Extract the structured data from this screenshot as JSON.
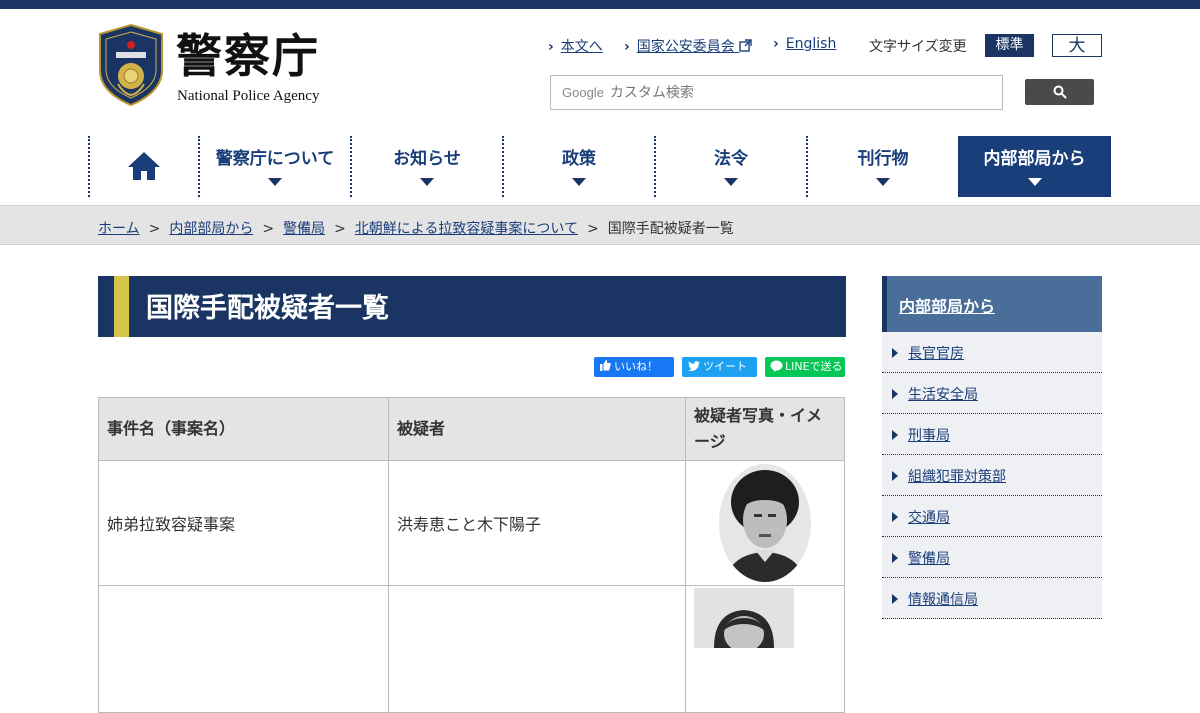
{
  "header": {
    "logo_jp": "警察庁",
    "logo_en": "National Police Agency",
    "links": [
      "本文へ",
      "国家公安委員会",
      "English"
    ],
    "font_size_label": "文字サイズ変更",
    "font_standard": "標準",
    "font_large": "大",
    "search_brand": "Google",
    "search_placeholder": "カスタム検索"
  },
  "nav": {
    "items": [
      "警察庁について",
      "お知らせ",
      "政策",
      "法令",
      "刊行物",
      "内部部局から"
    ],
    "active": "内部部局から"
  },
  "breadcrumb": {
    "items": [
      "ホーム",
      "内部部局から",
      "警備局",
      "北朝鮮による拉致容疑事案について"
    ],
    "current": "国際手配被疑者一覧",
    "separator": ">"
  },
  "page": {
    "title": "国際手配被疑者一覧",
    "share": {
      "facebook": "いいね！",
      "twitter": "ツイート",
      "line": "LINEで送る"
    }
  },
  "table": {
    "headers": [
      "事件名（事案名）",
      "被疑者",
      "被疑者写真・イメージ"
    ],
    "rows": [
      {
        "case": "姉弟拉致容疑事案",
        "suspect": "洪寿恵こと木下陽子"
      },
      {
        "case": "",
        "suspect": ""
      }
    ]
  },
  "sidebar": {
    "title": "内部部局から",
    "items": [
      "長官官房",
      "生活安全局",
      "刑事局",
      "組織犯罪対策部",
      "交通局",
      "警備局",
      "情報通信局"
    ]
  },
  "colors": {
    "navy": "#1a3563",
    "gold": "#d4c44a",
    "link": "#1a3e7a"
  }
}
